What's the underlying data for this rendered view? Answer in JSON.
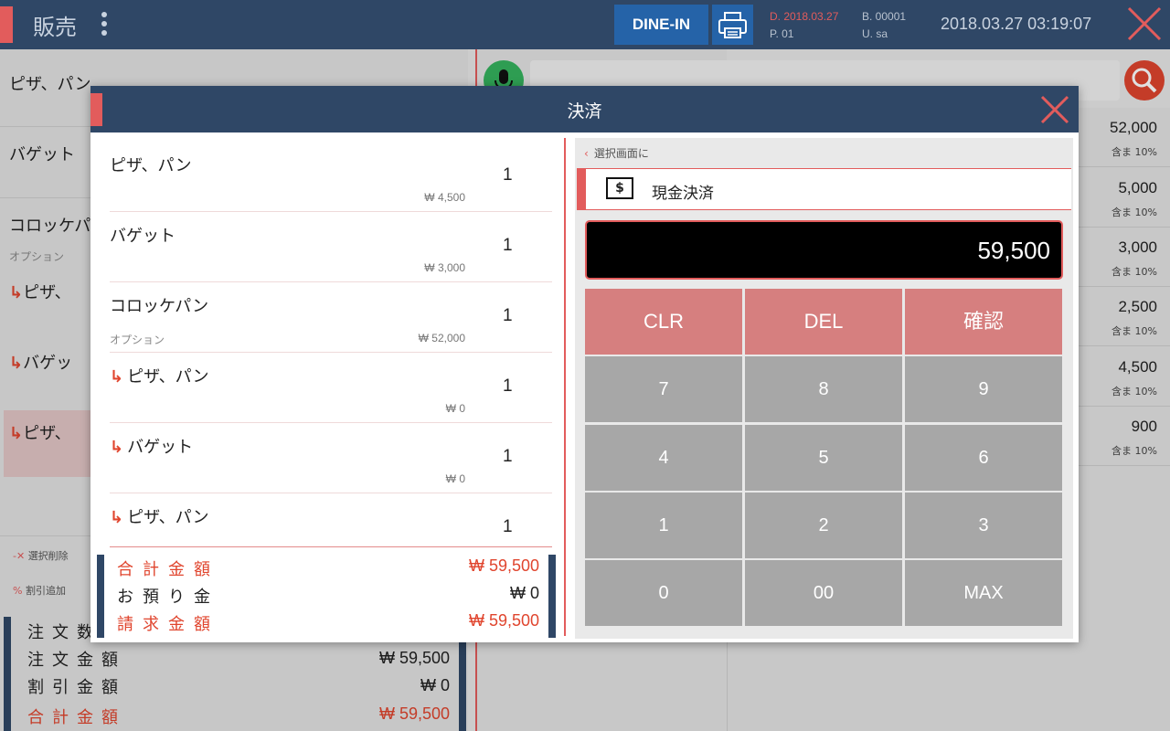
{
  "topbar": {
    "title": "販売",
    "dine_in": "DINE-IN",
    "date": "D. 2018.03.27",
    "pos": "P. 01",
    "bill": "B. 00001",
    "user": "U. sa",
    "clock": "2018.03.27 03:19:07",
    "icons": [
      "kebab-menu-icon",
      "printer-icon",
      "close-icon"
    ]
  },
  "background": {
    "cart": [
      {
        "name": "ピザ、パン"
      },
      {
        "name": "バゲット"
      },
      {
        "name": "コロッケパ"
      },
      {
        "option": "オプション"
      },
      {
        "name": "ピザ、"
      },
      {
        "name": "バゲッ"
      },
      {
        "name": "ピザ、"
      }
    ],
    "actions": {
      "delete_selected": "選択削除",
      "add_discount": "割引追加"
    },
    "summary": {
      "order_count_label": "注文数",
      "order_amount_label": "注文金額",
      "order_amount": "₩ 59,500",
      "discount_label": "割引金額",
      "discount": "₩ 0",
      "total_label": "合計金額",
      "total": "₩ 59,500"
    },
    "products": [
      {
        "price": "52,000",
        "tax": "含ま 10%"
      },
      {
        "price": "5,000",
        "tax": "含ま 10%"
      },
      {
        "price": "3,000",
        "tax": "含ま 10%"
      },
      {
        "price": "2,500",
        "tax": "含ま 10%"
      },
      {
        "price": "4,500",
        "tax": "含ま 10%"
      },
      {
        "price": "900",
        "tax": "含ま 10%"
      }
    ]
  },
  "modal": {
    "title": "決済",
    "items": [
      {
        "name": "ピザ、パン",
        "qty": "1",
        "price": "₩ 4,500",
        "sub": false,
        "option": ""
      },
      {
        "name": "バゲット",
        "qty": "1",
        "price": "₩ 3,000",
        "sub": false,
        "option": ""
      },
      {
        "name": "コロッケパン",
        "qty": "1",
        "price": "₩ 52,000",
        "sub": false,
        "option": "オプション"
      },
      {
        "name": "ピザ、パン",
        "qty": "1",
        "price": "₩ 0",
        "sub": true,
        "option": ""
      },
      {
        "name": "バゲット",
        "qty": "1",
        "price": "₩ 0",
        "sub": true,
        "option": ""
      },
      {
        "name": "ピザ、パン",
        "qty": "1",
        "price": "",
        "sub": true,
        "option": ""
      }
    ],
    "totals": {
      "total_label": "合計金額",
      "total": "₩ 59,500",
      "received_label": "お預り金",
      "received": "₩ 0",
      "billed_label": "請求金額",
      "billed": "₩ 59,500"
    },
    "payment": {
      "back_label": "選択画面に",
      "method_label": "現金決済",
      "method_icon": "$",
      "amount": "59,500",
      "keys": {
        "clr": "CLR",
        "del": "DEL",
        "confirm": "確認",
        "k7": "7",
        "k8": "8",
        "k9": "9",
        "k4": "4",
        "k5": "5",
        "k6": "6",
        "k1": "1",
        "k2": "2",
        "k3": "3",
        "k0": "0",
        "k00": "00",
        "max": "MAX"
      }
    }
  },
  "colors": {
    "header": "#2f4766",
    "accent": "#e25c5c",
    "button_blue": "#2563a8",
    "key_fn": "#d67f7f",
    "key_num": "#a7a7a7"
  }
}
